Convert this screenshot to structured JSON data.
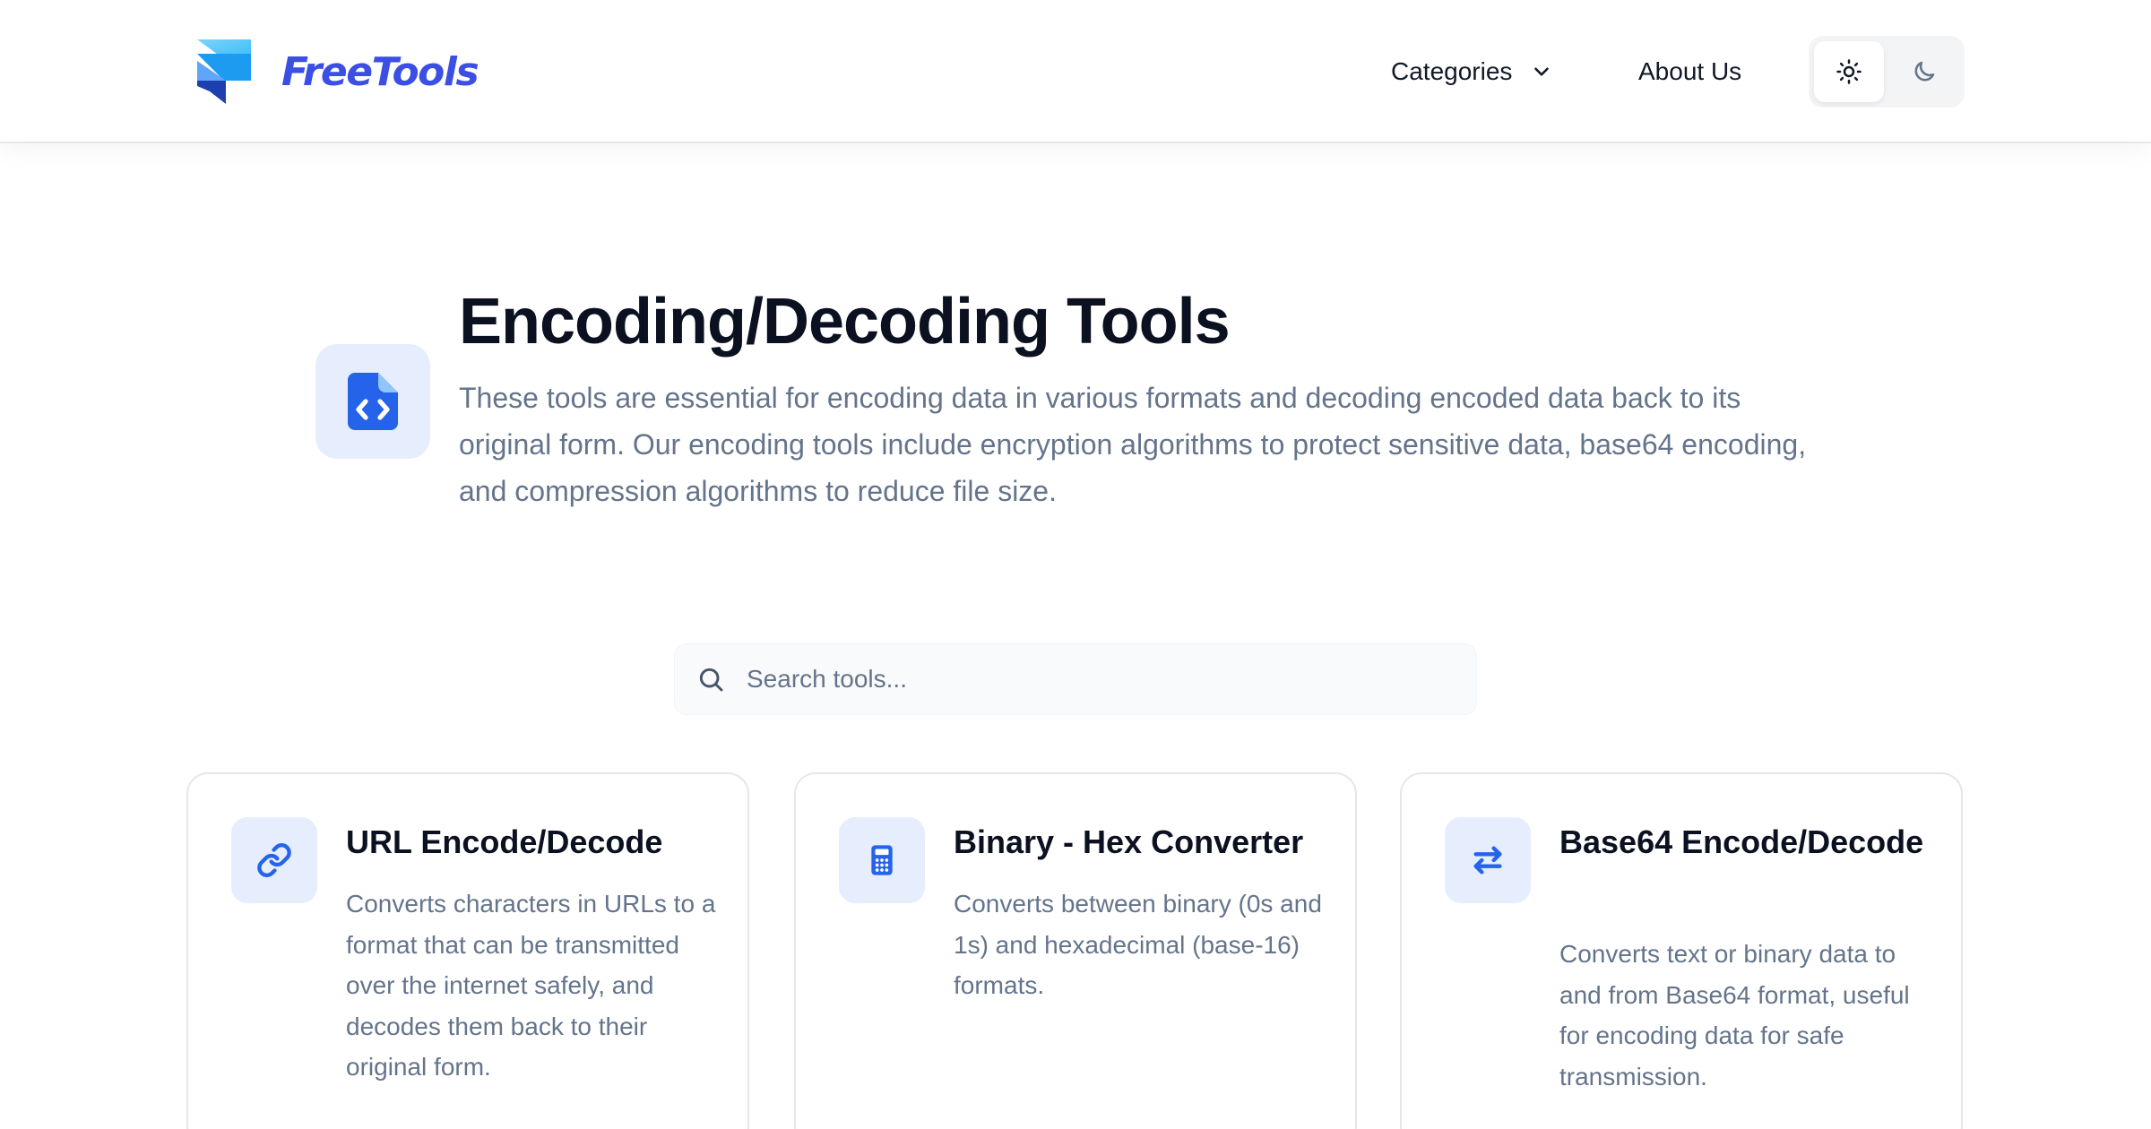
{
  "brand": {
    "name": "FreeTools",
    "colors": {
      "primary": "#3b4fe4",
      "accent": "#2563eb",
      "icon_bg": "#e6edfd"
    }
  },
  "nav": {
    "categories_label": "Categories",
    "about_label": "About Us"
  },
  "theme": {
    "light_icon": "sun-icon",
    "dark_icon": "moon-icon",
    "active": "light"
  },
  "hero": {
    "icon": "file-code-icon",
    "title": "Encoding/Decoding Tools",
    "description": "These tools are essential for encoding data in various formats and decoding encoded data back to its original form. Our encoding tools include encryption algorithms to protect sensitive data, base64 encoding, and compression algorithms to reduce file size."
  },
  "search": {
    "icon": "search-icon",
    "placeholder": "Search tools...",
    "value": ""
  },
  "tools": [
    {
      "icon": "link-icon",
      "title": "URL Encode/Decode",
      "description": "Converts characters in URLs to a format that can be transmitted over the internet safely, and decodes them back to their original form."
    },
    {
      "icon": "calculator-icon",
      "title": "Binary - Hex Converter",
      "description": "Converts between binary (0s and 1s) and hexadecimal (base-16) formats."
    },
    {
      "icon": "arrows-swap-icon",
      "title": "Base64 Encode/Decode",
      "description": "Converts text or binary data to and from Base64 format, useful for encoding data for safe transmission."
    }
  ]
}
